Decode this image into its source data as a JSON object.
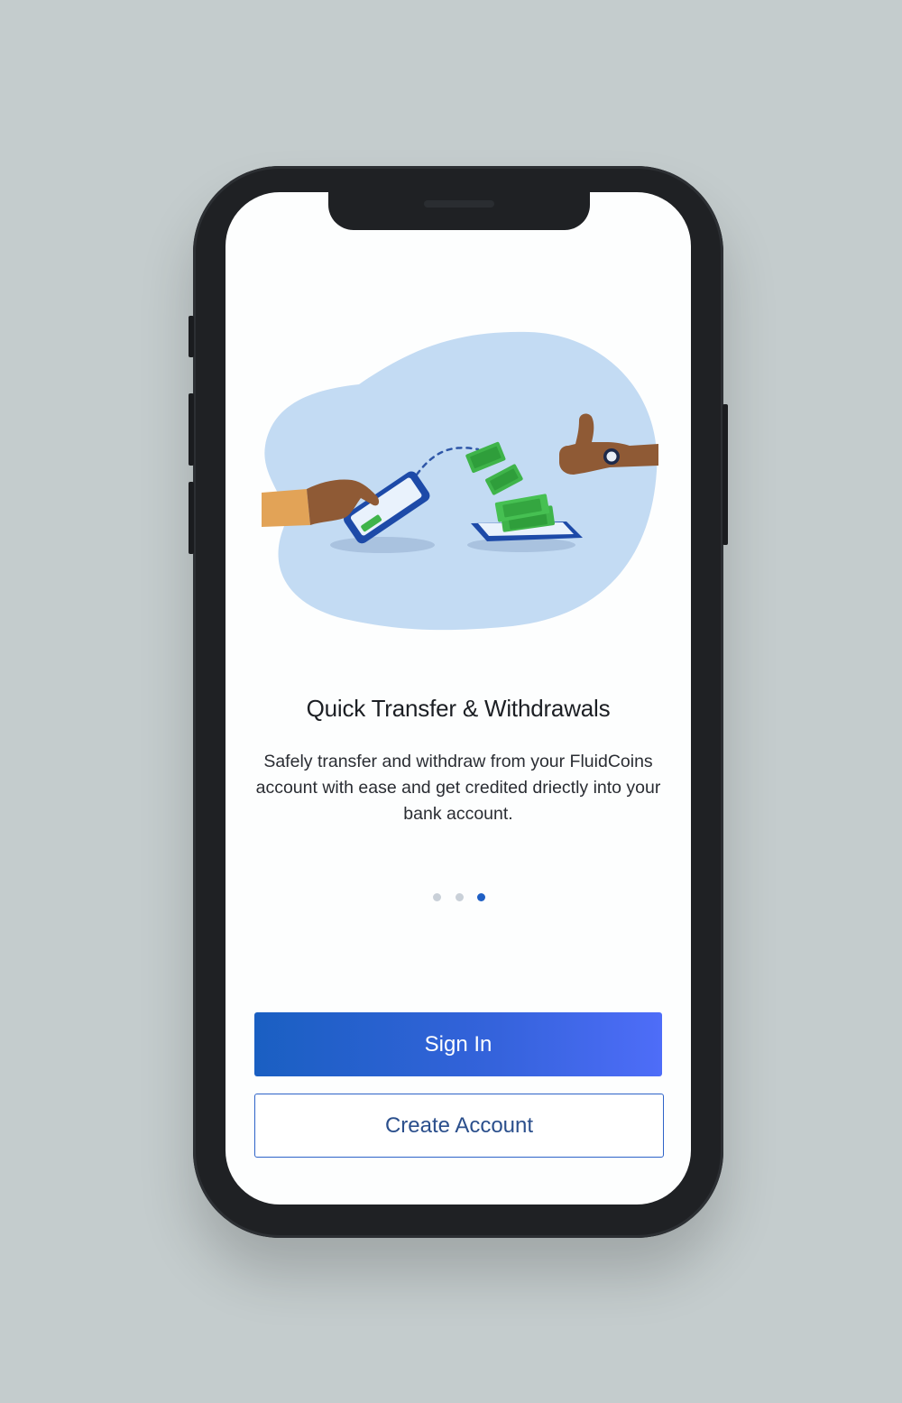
{
  "onboarding": {
    "title": "Quick Transfer & Withdrawals",
    "description": "Safely transfer and withdraw from your FluidCoins account with ease and get credited driectly into your bank account.",
    "pagination": {
      "total": 3,
      "active_index": 2
    }
  },
  "actions": {
    "sign_in_label": "Sign In",
    "create_account_label": "Create Account"
  },
  "colors": {
    "background": "#c4cccd",
    "accent": "#1f5fc4",
    "blob": "#c3dbf3",
    "cash": "#3fb44a"
  },
  "icons": {
    "illustration": "money-transfer-illustration"
  }
}
